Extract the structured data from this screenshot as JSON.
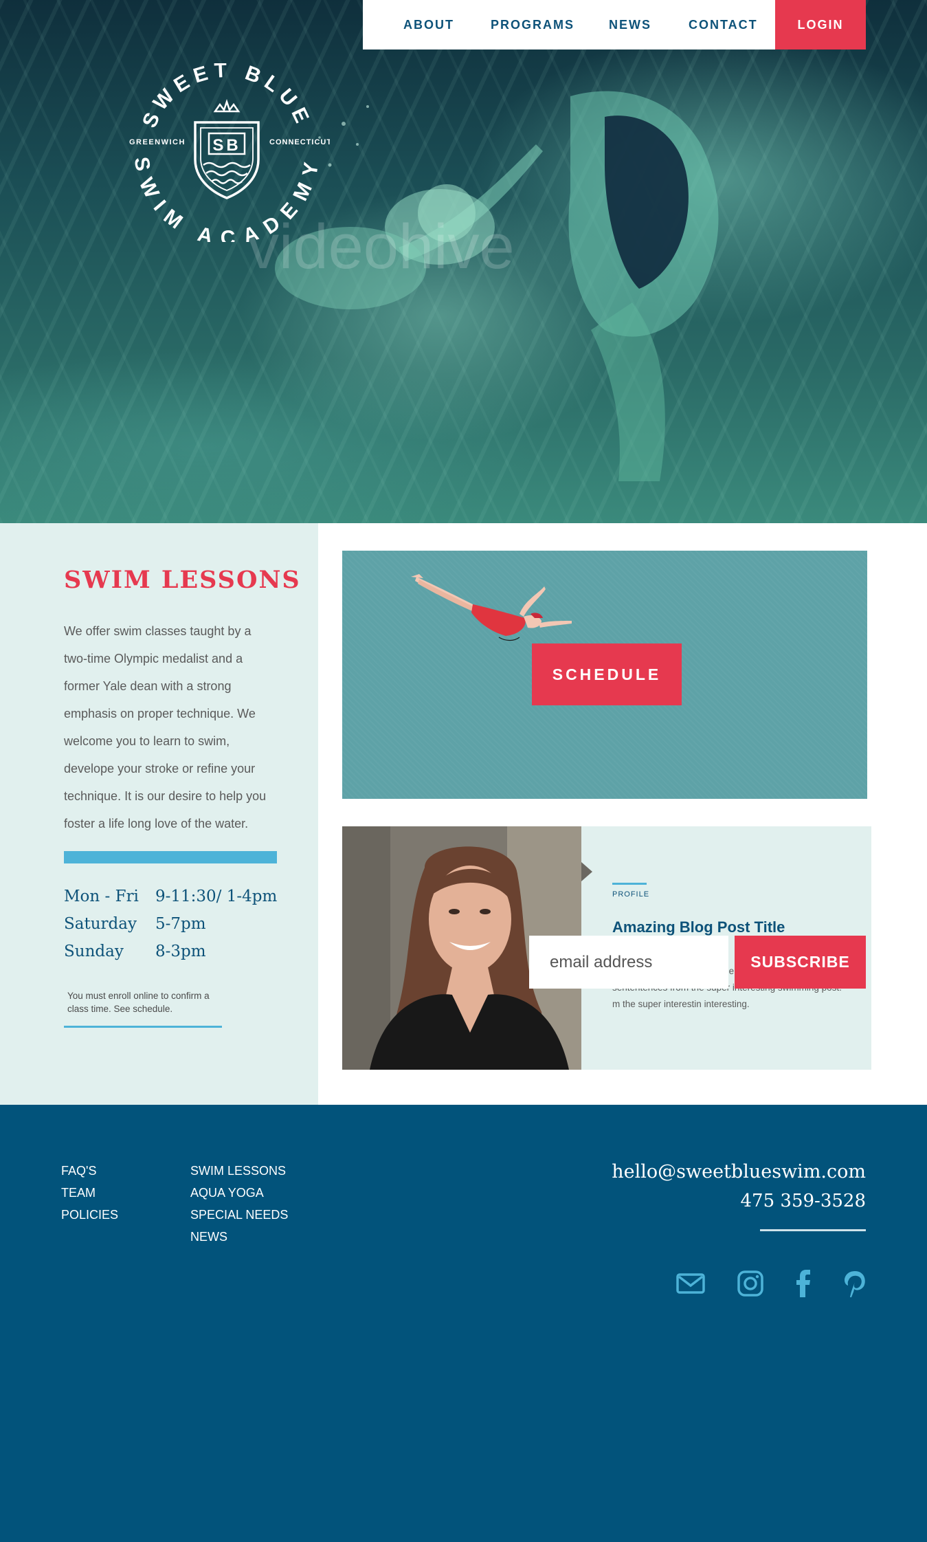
{
  "brand": {
    "logo_top_text": "SWEET BLUE",
    "logo_bottom_text": "SWIM ACADEMY",
    "logo_left_text": "GREENWICH",
    "logo_right_text": "CONNECTICUT",
    "logo_monogram": "SB",
    "watermark": "videohive"
  },
  "nav": {
    "items": [
      {
        "label": "ABOUT"
      },
      {
        "label": "PROGRAMS"
      },
      {
        "label": "NEWS"
      },
      {
        "label": "CONTACT"
      }
    ],
    "login_label": "LOGIN"
  },
  "lessons": {
    "title": "SWIM LESSONS",
    "body": "We offer swim classes taught by a two-time Olympic medalist and a former Yale dean with a strong emphasis on proper technique. We welcome you to learn to swim, develope your stroke or refine your technique. It is our desire to help you foster a life long love of the water.",
    "hours": [
      {
        "day": "Mon - Fri",
        "time": "9-11:30/ 1-4pm"
      },
      {
        "day": "Saturday",
        "time": "5-7pm"
      },
      {
        "day": "Sunday",
        "time": "8-3pm"
      }
    ],
    "note": "You must enroll online to confirm a class time. See schedule."
  },
  "schedule": {
    "button_label": "SCHEDULE"
  },
  "blog": {
    "label": "PROFILE",
    "title": "Amazing Blog Post Title Goes Here.",
    "excerpt": "Promoted content acan go here. A couple of sententences from the super interesting swimming post. m the super interestin interesting."
  },
  "footer": {
    "links_col1": [
      "FAQ'S",
      "TEAM",
      "POLICIES"
    ],
    "links_col2": [
      "SWIM LESSONS",
      "AQUA YOGA",
      "SPECIAL NEEDS",
      "NEWS"
    ],
    "email": "hello@sweetblueswim.com",
    "phone": "475 359-3528",
    "social_icons": [
      "mail-icon",
      "instagram-icon",
      "facebook-icon",
      "pinterest-icon"
    ],
    "subscribe": {
      "placeholder": "email address",
      "button_label": "SUBSCRIBE"
    }
  },
  "colors": {
    "accent_red": "#e6394f",
    "navy": "#0d5279",
    "footer_blue": "#02537b",
    "light_aqua": "#e1f0ee",
    "sky_blue": "#4db3d8"
  }
}
